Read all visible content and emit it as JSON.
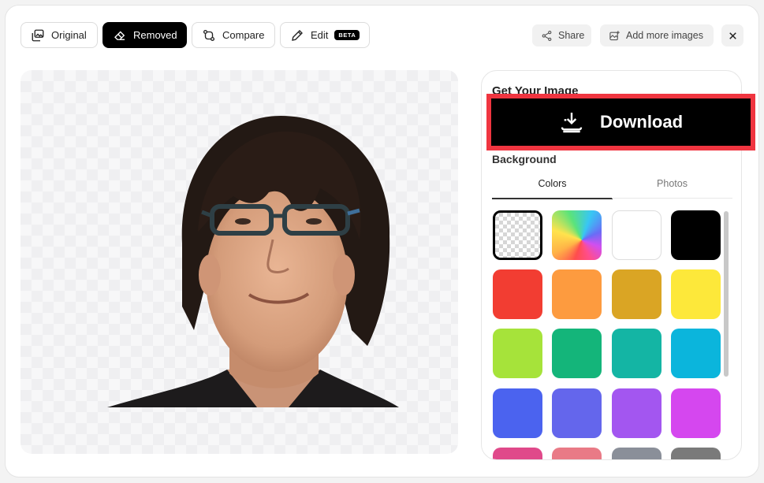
{
  "toolbar": {
    "original": "Original",
    "removed": "Removed",
    "compare": "Compare",
    "edit": "Edit",
    "beta": "BETA",
    "share": "Share",
    "add_more": "Add more images"
  },
  "panel": {
    "title": "Get Your Image",
    "download": "Download",
    "background_label": "Background",
    "tabs": [
      "Colors",
      "Photos"
    ],
    "active_tab": "Colors"
  },
  "swatches": [
    {
      "name": "transparent",
      "color": "transparent",
      "selected": true
    },
    {
      "name": "rainbow-gradient",
      "color": "gradient"
    },
    {
      "name": "white",
      "color": "#ffffff"
    },
    {
      "name": "black",
      "color": "#000000"
    },
    {
      "name": "red",
      "color": "#f23d32"
    },
    {
      "name": "orange",
      "color": "#fd9b3f"
    },
    {
      "name": "gold",
      "color": "#daa524"
    },
    {
      "name": "yellow",
      "color": "#fde83a"
    },
    {
      "name": "lime",
      "color": "#a6e33a"
    },
    {
      "name": "green",
      "color": "#14b57a"
    },
    {
      "name": "teal",
      "color": "#14b5a4"
    },
    {
      "name": "sky",
      "color": "#0bb5dc"
    },
    {
      "name": "blue",
      "color": "#4b63ef"
    },
    {
      "name": "indigo",
      "color": "#6466ec"
    },
    {
      "name": "purple",
      "color": "#a356f0"
    },
    {
      "name": "magenta",
      "color": "#d547ef"
    }
  ],
  "colors": {
    "accent": "#000000",
    "highlight": "#f03540"
  }
}
